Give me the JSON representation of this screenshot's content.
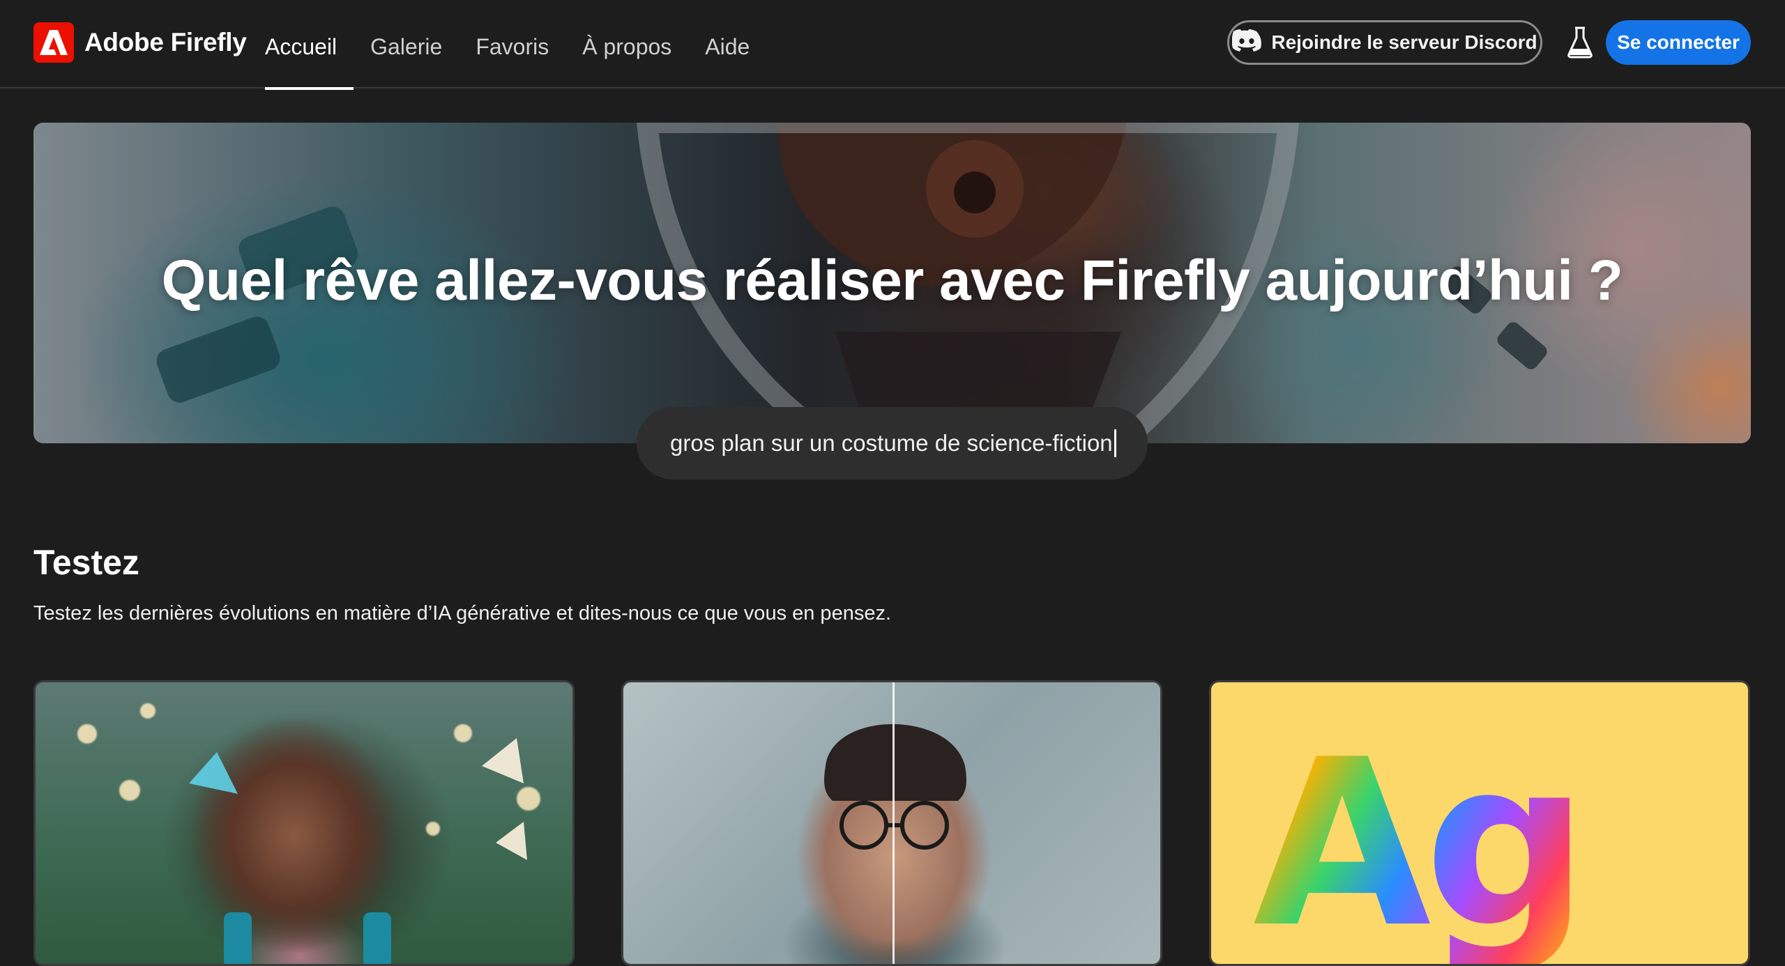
{
  "brand": {
    "name": "Adobe Firefly",
    "logo_icon": "adobe-a-icon",
    "logo_color": "#eb1000"
  },
  "nav": {
    "items": [
      {
        "label": "Accueil",
        "active": true
      },
      {
        "label": "Galerie",
        "active": false
      },
      {
        "label": "Favoris",
        "active": false
      },
      {
        "label": "À propos",
        "active": false
      },
      {
        "label": "Aide",
        "active": false
      }
    ]
  },
  "header_actions": {
    "discord_label": "Rejoindre le serveur Discord",
    "discord_icon": "discord-icon",
    "lab_icon": "flask-icon",
    "signin_label": "Se connecter",
    "signin_color": "#1473e6"
  },
  "hero": {
    "title": "Quel rêve allez-vous réaliser avec Firefly aujourd’hui ?",
    "prompt_text": "gros plan sur un costume de science-fiction"
  },
  "section": {
    "title": "Testez",
    "description": "Testez les dernières évolutions en matière d’IA générative et dites-nous ce que vous en pensez."
  },
  "cards": [
    {
      "image": "girl-with-butterflies-image"
    },
    {
      "image": "man-portrait-split-image"
    },
    {
      "image": "ag-fur-text-effect-image",
      "lettering": "Ag"
    }
  ],
  "colors": {
    "background": "#1d1d1d",
    "accent": "#1473e6"
  }
}
